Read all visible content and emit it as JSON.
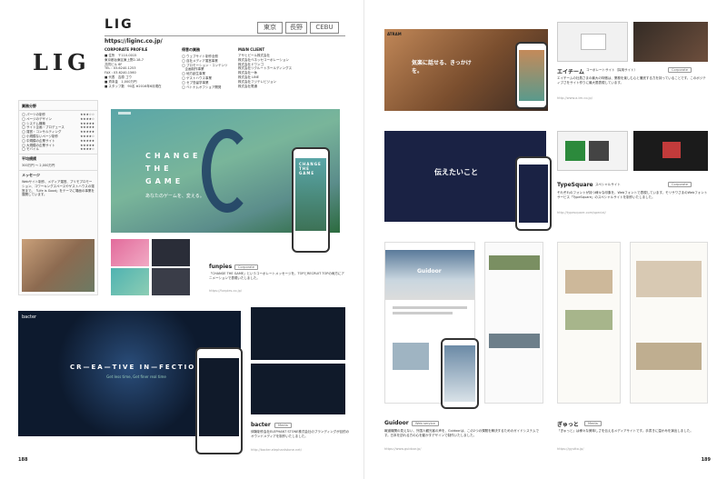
{
  "left": {
    "logo": "LIG",
    "title": "LIG",
    "cities": [
      "東京",
      "長野",
      "CEBU"
    ],
    "url": "https://liginc.co.jp/",
    "profile_heading": "CORPORATE PROFILE",
    "tools_heading": "得意の業務",
    "clients_heading": "MAIN CLIENT",
    "profile_lines": [
      "■ 住所　〒110-0015",
      "東京都台東区東上野2-18-7",
      "共同ビル 6F",
      "TEL : 03-6240-1253",
      "FAX : 03-6240-1560",
      "■ 代表　吉原 ゴウ",
      "■ 資本金　1,000万円",
      "■ スタッフ数　90名 ※2016年6月現在"
    ],
    "tools_lines": [
      "◯ ウェブサイト制作全般",
      "◯ 自社メディア運営事業",
      "◯ プロモーション・コンテンツ",
      "　企画制作事業",
      "◯ 地方創生事業",
      "◯ ゲストハウス事業",
      "◯ セブ島留学事業",
      "◯ ベトナムオフショア開発"
    ],
    "clients_lines": [
      "アサヒビール株式会社",
      "株式会社ベネッセコーポレーション",
      "株式会社ドワンゴ",
      "株式会社リクルートホールディングス",
      "株式会社一休",
      "株式会社 LINE",
      "株式会社フジテレビジョン",
      "株式会社電通"
    ],
    "skills_heading": "業務分野",
    "skills": [
      {
        "label": "◯ パーツの制作",
        "stars": "★★★☆☆"
      },
      {
        "label": "◯ ページのデザイン",
        "stars": "★★★★☆"
      },
      {
        "label": "◯ システム構築",
        "stars": "★★★★★"
      },
      {
        "label": "◯ サイト企画・プロデュース",
        "stars": "★★★★★"
      },
      {
        "label": "◯ 運営・コンサルティング",
        "stars": "★★★★★"
      },
      {
        "label": "◯ 小規模ないページ制作",
        "stars": "★★★★☆"
      },
      {
        "label": "◯ 中規模の企業サイト",
        "stars": "★★★★★"
      },
      {
        "label": "◯ 大規模の企業サイト",
        "stars": "★★★★★"
      },
      {
        "label": "◯ モバイル",
        "stars": "★★★★☆"
      }
    ],
    "budget_heading": "平均規模",
    "budget": "300万円 〜 2,000万円",
    "message_heading": "メッセージ",
    "message": "Webサイト制作、メディア運営、プリモプロモーション、コワーキングスペースやゲストハウスの運営まで。「Life is Good」をテーマに場面の事業を展開しています。",
    "hero_text": [
      "CHANGE",
      "THE",
      "GAME"
    ],
    "hero_sub": "あなたのゲームを、変える。",
    "mobile_text": "CHANGE THE GAME",
    "funpies_title": "funpies",
    "funpies_badge": "Corporate",
    "funpies_desc": "「CHANGE THE GAME」というコーポレートメッセージを、TOPとRECRUIT TOPの両方にアニメーションで表現いたしました。",
    "funpies_url": "https://funpies.co.jp/",
    "bacter_title": "bacter",
    "bacter_badge": "Media",
    "bacter_desc": "体験制作会社ELEPHANT STONE株式会社のブランディングが目的のオウンドメディアを制作いたしました。",
    "bacter_url": "http://bacter.elephantstone.net/",
    "bacter_hero": "CR—EA—TIVE IN—FECTION",
    "bacter_sub": "Get less time, Get finer real time",
    "page_number": "188"
  },
  "right": {
    "atrium_header": "ATRAM",
    "atrium_hero": "気楽に話せる、きっかけを。",
    "atrium_title": "エイチーム",
    "atrium_badge": "Corporate",
    "atrium_sub": "コーポレートサイト（採用サイト）",
    "atrium_desc": "エイチームの社員さまの最大の特徴は、業務を楽しむ心と徹底する力を持っていることです。このポジティブさをサイト作りに最大限表現しています。",
    "atrium_url": "http://www.a-tm.co.jp/",
    "ts_hero": "伝えたいこと",
    "ts_title": "TypeSquare",
    "ts_badge": "Corporate",
    "ts_sub": "スペシャルサイト",
    "ts_desc": "それぞれのフォントが持つ様々な印象を、Webフォントで表現しています。モリサワさまのWebフォントサービス「TypeSquare」のスペシャルサイトを制作いたしました。",
    "ts_url": "http://typesquare.com/special/",
    "guidoor_title": "Guidoor",
    "guidoor_badge": "Web service",
    "guidoor_desc": "報道機関の見えない、外国人観光客の声を、Guidoorは、この2つの課題を解決するためのガイドシステムです。日本を訪れる方の心を動かすデザインで制作いたしました。",
    "guidoor_url": "https://www.guidoor.jp/",
    "guidoor_brand": "Guidoor",
    "gurutto_title": "ぎゅっと",
    "gurutto_badge": "Media",
    "gurutto_desc": "「ぎゅっと」は様々な美味しさを伝えるメディアサイトです。手書きに温かみを演出しました。",
    "gurutto_url": "https://gyutto.jp/",
    "page_number": "189"
  },
  "colors": {
    "accent": "#1f4c8f",
    "hero_green": "#6fb59b",
    "dark_navy": "#0d1a2e",
    "gray_rule": "#999999"
  }
}
